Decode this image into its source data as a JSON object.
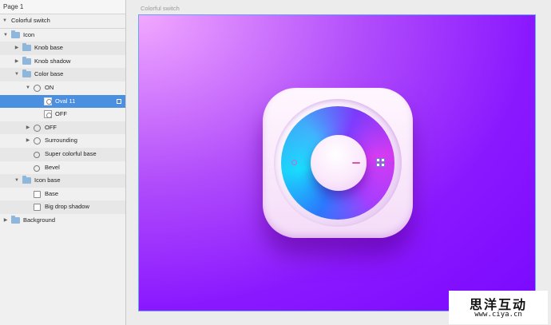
{
  "sidebar": {
    "page_label": "Page 1",
    "artboard_label": "Colorful switch",
    "layers": {
      "icon": "Icon",
      "knob_base": "Knob base",
      "knob_shadow": "Knob shadow",
      "color_base": "Color base",
      "on": "ON",
      "oval_11": "Oval 11",
      "off_inner": "OFF",
      "off": "OFF",
      "surrounding": "Surrounding",
      "super_colorful_base": "Super colorful base",
      "bevel": "Bevel",
      "icon_base": "Icon base",
      "base": "Base",
      "big_drop_shadow": "Big drop shadow",
      "background": "Background"
    }
  },
  "canvas": {
    "artboard_title": "Colorful switch"
  },
  "watermark": {
    "chinese": "思洋互动",
    "url": "www.ciya.cn"
  },
  "colors": {
    "selection": "#4b8fe0",
    "artboard_border": "#69a6f0",
    "background_purple": "#7a08ff",
    "knob_accent": "#e04fb1"
  }
}
